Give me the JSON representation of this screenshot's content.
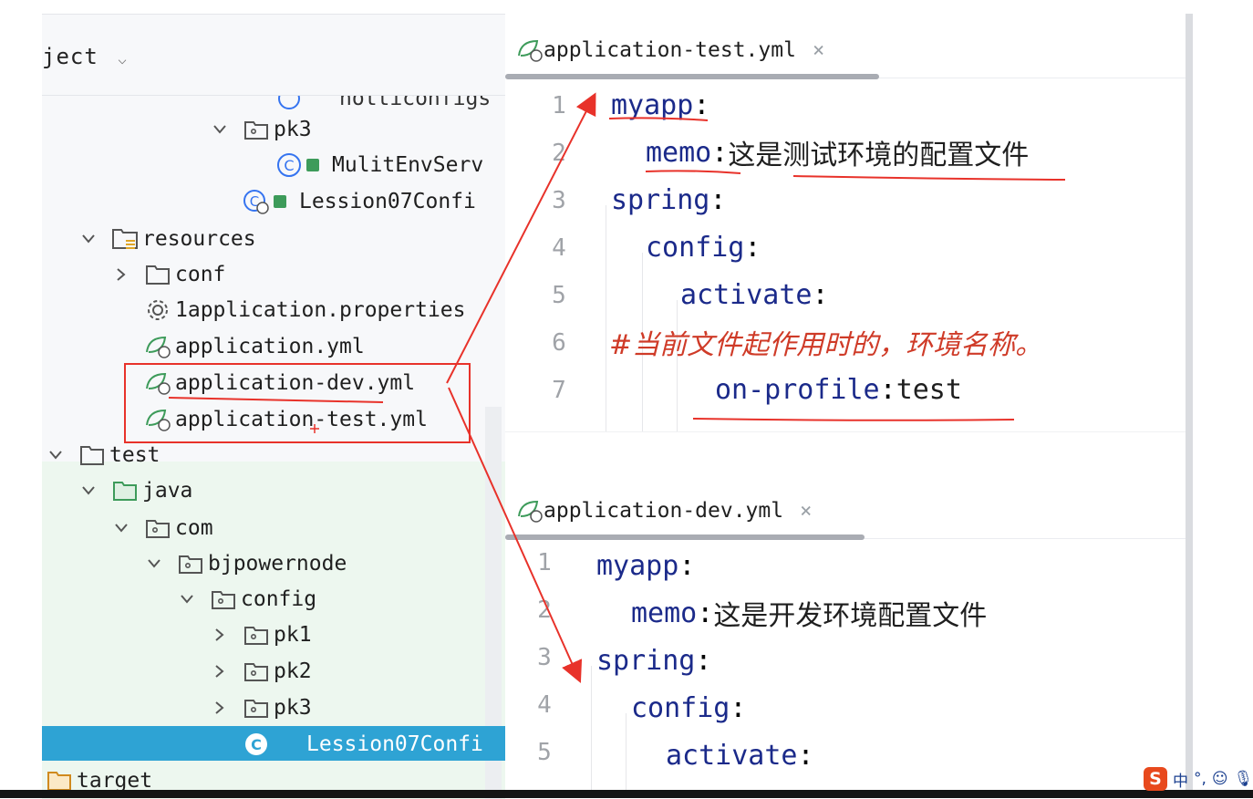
{
  "project_panel": {
    "header_title": "ject",
    "tree_items": [
      {
        "id": "partial",
        "label": "notticonfigs"
      },
      {
        "id": "pk3a",
        "label": "pk3"
      },
      {
        "id": "mulit",
        "label": "MulitEnvServ"
      },
      {
        "id": "lession_main",
        "label": "Lession07Confi"
      },
      {
        "id": "resources",
        "label": "resources"
      },
      {
        "id": "conf",
        "label": "conf"
      },
      {
        "id": "props",
        "label": "1application.properties"
      },
      {
        "id": "appyml",
        "label": "application.yml"
      },
      {
        "id": "appdev",
        "label": "application-dev.yml"
      },
      {
        "id": "apptest",
        "label": "application-test.yml"
      },
      {
        "id": "test",
        "label": "test"
      },
      {
        "id": "java",
        "label": "java"
      },
      {
        "id": "com",
        "label": "com"
      },
      {
        "id": "bjp",
        "label": "bjpowernode"
      },
      {
        "id": "config",
        "label": "config"
      },
      {
        "id": "pk1",
        "label": "pk1"
      },
      {
        "id": "pk2",
        "label": "pk2"
      },
      {
        "id": "pk3b",
        "label": "pk3"
      },
      {
        "id": "lession_test",
        "label": "Lession07Confi"
      },
      {
        "id": "target",
        "label": "target"
      }
    ]
  },
  "editor_test": {
    "tab_label": "application-test.yml",
    "close_glyph": "×",
    "lines": [
      {
        "n": "1",
        "key": "myapp",
        "colon": ":",
        "val": ""
      },
      {
        "n": "2",
        "key": "memo",
        "colon": ": ",
        "val": "这是测试环境的配置文件"
      },
      {
        "n": "3",
        "key": "spring",
        "colon": ":",
        "val": ""
      },
      {
        "n": "4",
        "key": "config",
        "colon": ":",
        "val": ""
      },
      {
        "n": "5",
        "key": "activate",
        "colon": ":",
        "val": ""
      },
      {
        "n": "6",
        "comment": "#当前文件起作用时的，环境名称。"
      },
      {
        "n": "7",
        "key": "on-profile",
        "colon": ": ",
        "val": "test"
      }
    ]
  },
  "editor_dev": {
    "tab_label": "application-dev.yml",
    "close_glyph": "×",
    "lines": [
      {
        "n": "1",
        "key": "myapp",
        "colon": ":",
        "val": ""
      },
      {
        "n": "2",
        "key": "memo",
        "colon": ": ",
        "val": "这是开发环境配置文件"
      },
      {
        "n": "3",
        "key": "spring",
        "colon": ":",
        "val": ""
      },
      {
        "n": "4",
        "key": "config",
        "colon": ":",
        "val": ""
      },
      {
        "n": "5",
        "key": "activate",
        "colon": ":",
        "val": ""
      }
    ]
  },
  "ime_bar": {
    "logo": "S",
    "mode": "中",
    "punct": "°,"
  },
  "colors": {
    "annotation": "#e8322a",
    "selection": "#2ea3d4",
    "key": "#1b2a8a",
    "comment": "#cf3b28"
  },
  "icons": {
    "folder": "folder-icon",
    "package": "package-icon",
    "resources": "resources-folder-icon",
    "yaml": "spring-yaml-icon",
    "properties": "gear-icon",
    "class": "class-icon",
    "chevron": "chevron-icon"
  }
}
